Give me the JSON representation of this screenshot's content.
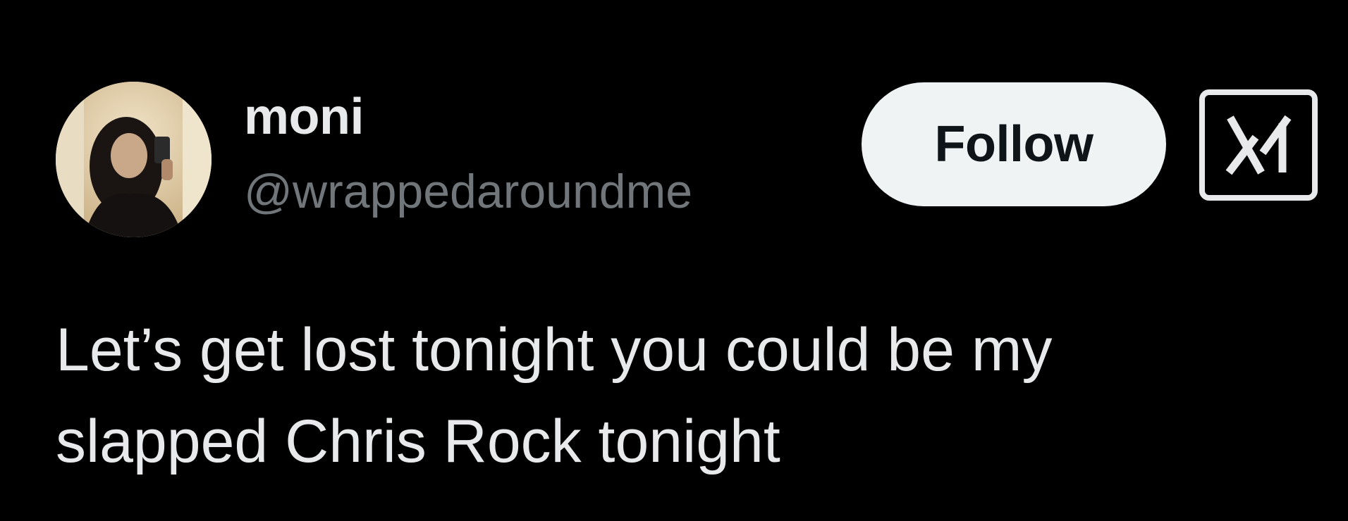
{
  "theme": {
    "background": "#000000",
    "text_primary": "#e7e9ea",
    "text_secondary": "#71767b",
    "button_background": "#eff3f4",
    "button_text": "#0f1419"
  },
  "author": {
    "display_name": "moni",
    "handle": "@wrappedaroundme",
    "avatar_icon": "profile-photo"
  },
  "actions": {
    "follow_label": "Follow",
    "platform_icon": "x-logo-icon"
  },
  "tweet": {
    "lines": [
      "Let’s get lost tonight you could be my",
      "slapped Chris Rock tonight"
    ]
  }
}
